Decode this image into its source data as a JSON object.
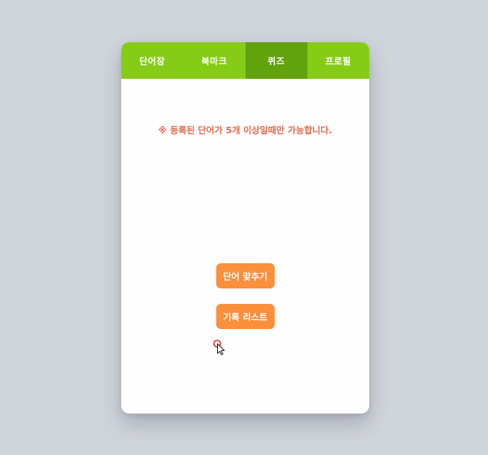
{
  "tabs": [
    {
      "label": "단어장",
      "active": false
    },
    {
      "label": "북마크",
      "active": false
    },
    {
      "label": "퀴즈",
      "active": true
    },
    {
      "label": "프로필",
      "active": false
    }
  ],
  "quiz": {
    "notice": "※ 등록된 단어가 5개 이상일때만 가능합니다.",
    "match_button": "단어 맞추기",
    "history_button": "기록 리스트"
  },
  "colors": {
    "tab_bar": "#86cc17",
    "tab_active": "#62a20d",
    "notice_text": "#e06c4e",
    "button": "#fa8f3c",
    "background": "#d0d4db"
  }
}
